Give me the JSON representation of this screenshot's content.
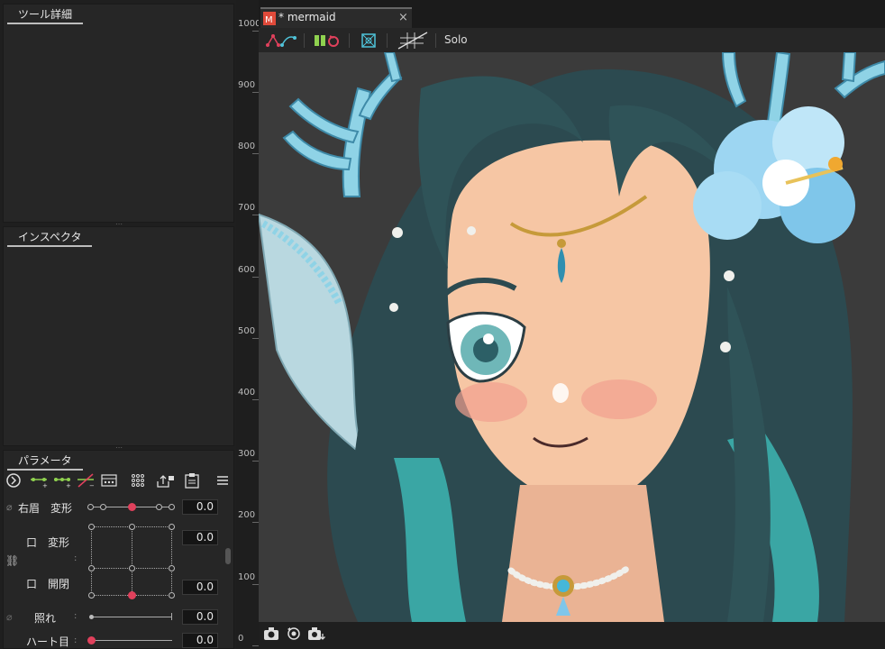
{
  "panels": {
    "tool_details": {
      "title": "ツール詳細"
    },
    "inspector": {
      "title": "インスペクタ"
    },
    "parameters": {
      "title": "パラメータ"
    }
  },
  "params": [
    {
      "label": "右眉　変形",
      "value": "0.0"
    },
    {
      "label": "口　変形",
      "value": "0.0"
    },
    {
      "label": "口　開閉",
      "value": "0.0"
    },
    {
      "label": "照れ",
      "value": "0.0"
    },
    {
      "label": "ハート目",
      "value": "0.0"
    }
  ],
  "params_colon": ":",
  "ruler": [
    "1000",
    "900",
    "800",
    "700",
    "600",
    "500",
    "400",
    "300",
    "200",
    "100",
    "0"
  ],
  "document_tab": {
    "title": "* mermaid",
    "close": "×"
  },
  "view_toolbar": {
    "solo": "Solo"
  },
  "colors": {
    "accent_red": "#e0415c",
    "background": "#3b3b3b",
    "hair": "#2f5358",
    "skin": "#f6c6a4",
    "coral": "#8fd3e6"
  }
}
